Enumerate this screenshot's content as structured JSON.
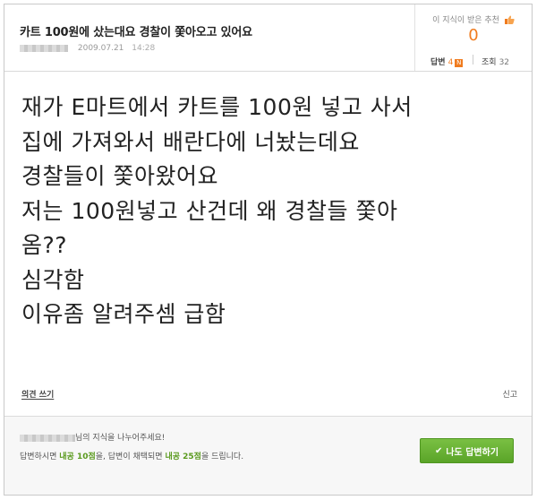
{
  "question": {
    "title": "카트 100원에 샀는대요 경찰이 쫓아오고 있어요",
    "date": "2009.07.21",
    "time": "14:28"
  },
  "sidebox": {
    "recommend_label": "이 지식이 받은 추천",
    "recommend_count": "0",
    "answers_label": "답변",
    "answers_count": "4",
    "new_badge": "N",
    "views_label": "조회",
    "views_count": "32"
  },
  "content": {
    "lines": [
      "재가 E마트에서 카트를 100원 넣고 사서",
      "집에 가져와서 배란다에 너놨는데요",
      "경찰들이 쫓아왔어요",
      "저는 100원넣고 산건데 왜 경찰들 쫓아",
      "옴??",
      "심각함",
      "이유좀 알려주셈 급함"
    ]
  },
  "actions": {
    "opinion": "의견 쓰기",
    "report": "신고"
  },
  "footer": {
    "share_text": "님의 지식을 나누어주세요!",
    "reward_prefix": "답변하시면 ",
    "reward_pts1": "내공 10점",
    "reward_mid": "을, 답변이 채택되면 ",
    "reward_pts2": "내공 25점",
    "reward_suffix": "을 드립니다.",
    "button_label": "나도 답변하기"
  },
  "colors": {
    "accent_orange": "#f07b1e",
    "button_green": "#6ab336"
  }
}
